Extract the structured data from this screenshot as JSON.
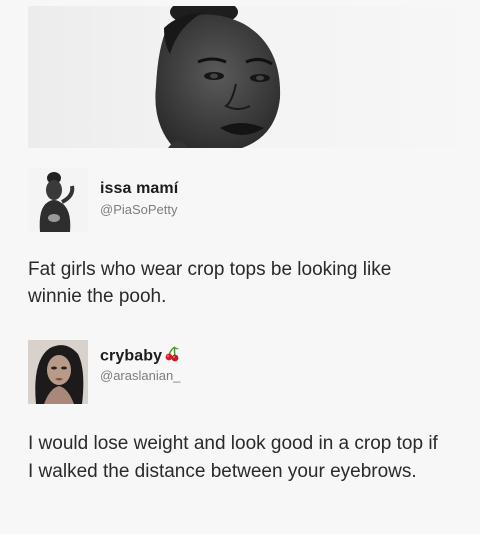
{
  "post1": {
    "name": "issa mamí",
    "handle": "@PiaSoPetty",
    "text": "Fat girls who wear crop tops be looking like winnie the pooh."
  },
  "post2": {
    "name": "crybaby",
    "handle": "@araslanian_",
    "badge_icon": "cherry-icon",
    "text": "I would lose weight and look good in a crop top if I walked the distance between your eyebrows."
  },
  "colors": {
    "background": "#f7f7f7",
    "name_text": "#1c1c1c",
    "handle_text": "#7d7d7d",
    "body_text": "#2a2a2a"
  }
}
